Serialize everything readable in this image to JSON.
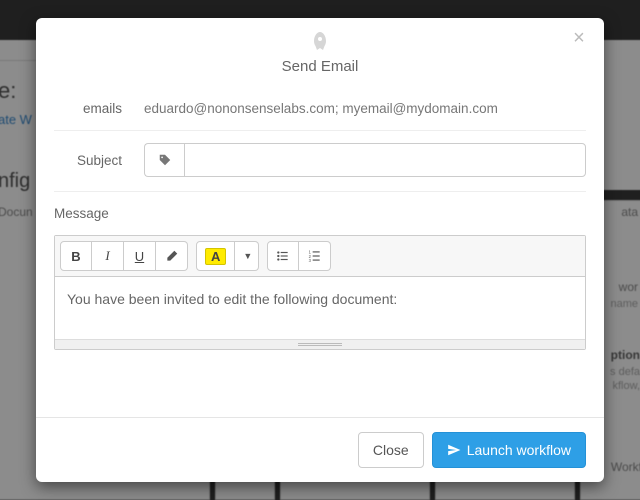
{
  "modal": {
    "title": "Send Email",
    "close_symbol": "×"
  },
  "fields": {
    "emails_label": "emails",
    "emails_value": "eduardo@nononsenselabs.com; myemail@mydomain.com",
    "subject_label": "Subject",
    "subject_value": "",
    "message_label": "Message",
    "message_body": "You have been invited to edit the following document:"
  },
  "toolbar": {
    "bold": "B",
    "italic": "I",
    "underline": "U",
    "highlight_letter": "A"
  },
  "footer": {
    "close": "Close",
    "launch": "Launch workflow"
  },
  "colors": {
    "primary": "#2e9fe6",
    "highlight": "#ffeb00"
  },
  "background": {
    "title_fragment": "e:",
    "link_fragment": "ate W",
    "nfig": "nfig",
    "docun": "Docun",
    "ata": "ata",
    "wor": "wor",
    "name": "name",
    "ption": "ption",
    "deft": "s defa",
    "kflow": "kflow,",
    "workflow": "Workflow"
  }
}
